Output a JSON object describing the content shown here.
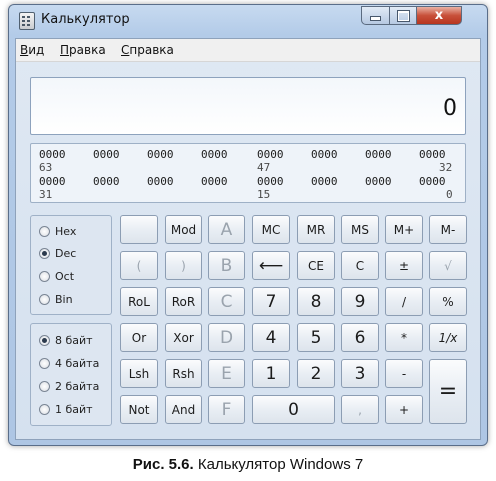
{
  "window": {
    "title": "Калькулятор",
    "controls": {
      "minimize": "",
      "maximize": "",
      "close": "x"
    }
  },
  "menu": [
    {
      "first": "В",
      "rest": "ид"
    },
    {
      "first": "П",
      "rest": "равка"
    },
    {
      "first": "С",
      "rest": "правка"
    }
  ],
  "display": {
    "value": "0"
  },
  "bits": {
    "row1": [
      "0000",
      "0000",
      "0000",
      "0000",
      "0000",
      "0000",
      "0000",
      "0000"
    ],
    "row1_index": [
      "63",
      "47",
      "32"
    ],
    "row2": [
      "0000",
      "0000",
      "0000",
      "0000",
      "0000",
      "0000",
      "0000",
      "0000"
    ],
    "row2_index": [
      "31",
      "15",
      "0"
    ]
  },
  "radix": [
    {
      "label": "Hex",
      "selected": false
    },
    {
      "label": "Dec",
      "selected": true
    },
    {
      "label": "Oct",
      "selected": false
    },
    {
      "label": "Bin",
      "selected": false
    }
  ],
  "wordsize": [
    {
      "label": "8 байт",
      "selected": true
    },
    {
      "label": "4 байта",
      "selected": false
    },
    {
      "label": "2 байта",
      "selected": false
    },
    {
      "label": "1 байт",
      "selected": false
    }
  ],
  "keys": {
    "blank": "",
    "mod": "Mod",
    "a": "A",
    "mc": "MC",
    "mr": "MR",
    "ms": "MS",
    "mplus": "M+",
    "mminus": "M-",
    "lparen": "(",
    "rparen": ")",
    "b": "B",
    "back": "⟵",
    "ce": "CE",
    "c": "C",
    "plusminus": "±",
    "sqrt": "√",
    "rol": "RoL",
    "ror": "RoR",
    "c_hex": "C",
    "d7": "7",
    "d8": "8",
    "d9": "9",
    "div": "/",
    "pct": "%",
    "or": "Or",
    "xor": "Xor",
    "d": "D",
    "d4": "4",
    "d5": "5",
    "d6": "6",
    "mul": "*",
    "recip": "1/x",
    "lsh": "Lsh",
    "rsh": "Rsh",
    "e": "E",
    "d1": "1",
    "d2": "2",
    "d3": "3",
    "minus": "-",
    "eq": "=",
    "not": "Not",
    "and": "And",
    "f": "F",
    "d0": "0",
    "dot": ",",
    "plus": "+"
  },
  "caption": {
    "label": "Рис. 5.6.",
    "text": " Калькулятор Windows 7"
  }
}
